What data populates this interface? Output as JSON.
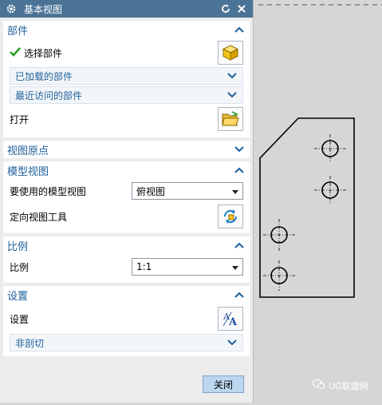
{
  "dialog": {
    "title": "基本视图",
    "close_label": "关闭"
  },
  "sections": {
    "part": {
      "label": "部件",
      "select_part": "选择部件",
      "loaded_parts": "已加载的部件",
      "recent_parts": "最近访问的部件",
      "open": "打开"
    },
    "view_origin": {
      "label": "视图原点"
    },
    "model_view": {
      "label": "模型视图",
      "model_view_to_use": "要使用的模型视图",
      "model_view_value": "俯视图",
      "orient_tool": "定向视图工具"
    },
    "scale": {
      "label": "比例",
      "scale_label": "比例",
      "scale_value": "1:1"
    },
    "settings": {
      "label": "设置",
      "settings_label": "设置",
      "non_section": "非剖切"
    }
  },
  "watermark": {
    "text": "UG联盟网"
  },
  "colors": {
    "titlebar": "#4b7396",
    "section_label": "#1e5f9a",
    "close_button": "#bcd6ee",
    "canvas": "#d6d6d6"
  }
}
